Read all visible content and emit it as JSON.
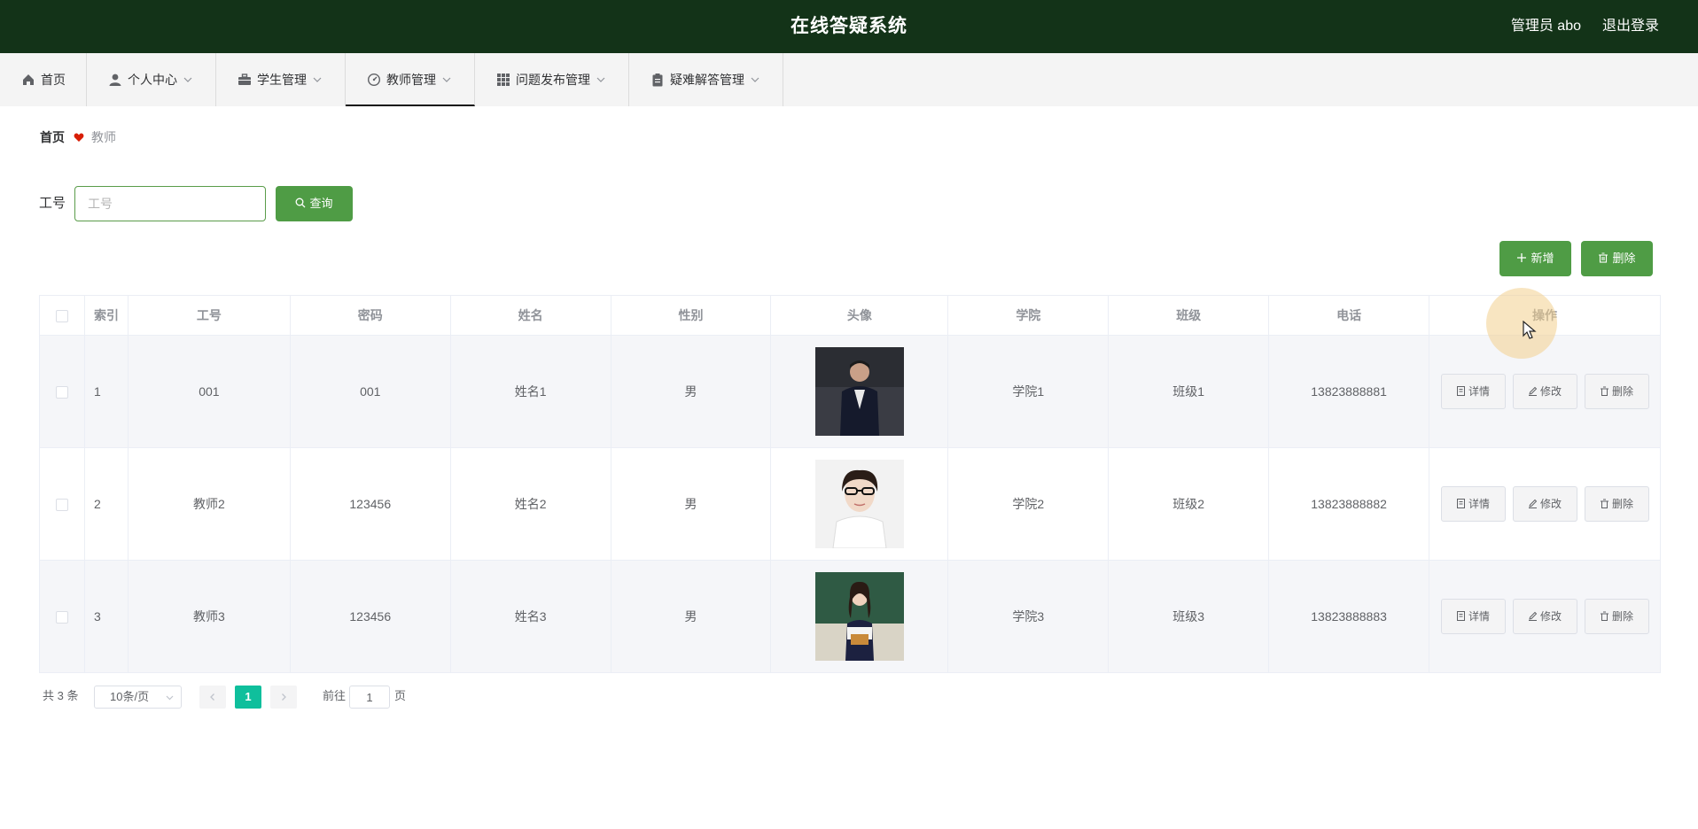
{
  "header": {
    "title": "在线答疑系统",
    "user": "管理员 abo",
    "logout": "退出登录"
  },
  "nav": {
    "items": [
      {
        "label": "首页",
        "icon": "home-icon"
      },
      {
        "label": "个人中心",
        "icon": "user-icon"
      },
      {
        "label": "学生管理",
        "icon": "briefcase-icon"
      },
      {
        "label": "教师管理",
        "icon": "dashboard-icon",
        "active": true
      },
      {
        "label": "问题发布管理",
        "icon": "grid-icon"
      },
      {
        "label": "疑难解答管理",
        "icon": "clipboard-icon"
      }
    ]
  },
  "breadcrumb": {
    "home": "首页",
    "current": "教师"
  },
  "search": {
    "label": "工号",
    "placeholder": "工号",
    "value": "",
    "button": "查询"
  },
  "actions": {
    "add": "新增",
    "delete": "删除"
  },
  "table": {
    "columns": [
      "索引",
      "工号",
      "密码",
      "姓名",
      "性别",
      "头像",
      "学院",
      "班级",
      "电话",
      "操作"
    ],
    "rows": [
      {
        "index": "1",
        "id": "001",
        "password": "001",
        "name": "姓名1",
        "gender": "男",
        "college": "学院1",
        "class": "班级1",
        "phone": "13823888881"
      },
      {
        "index": "2",
        "id": "教师2",
        "password": "123456",
        "name": "姓名2",
        "gender": "男",
        "college": "学院2",
        "class": "班级2",
        "phone": "13823888882"
      },
      {
        "index": "3",
        "id": "教师3",
        "password": "123456",
        "name": "姓名3",
        "gender": "男",
        "college": "学院3",
        "class": "班级3",
        "phone": "13823888883"
      }
    ],
    "row_buttons": {
      "detail": "详情",
      "edit": "修改",
      "delete": "删除"
    }
  },
  "pagination": {
    "total": "共 3 条",
    "page_size": "10条/页",
    "current_page": "1",
    "goto_label": "前往",
    "goto_value": "1",
    "goto_unit": "页"
  },
  "colors": {
    "header_bg": "#133318",
    "primary_green": "#4f9c45",
    "page_active": "#0fbf9c"
  }
}
